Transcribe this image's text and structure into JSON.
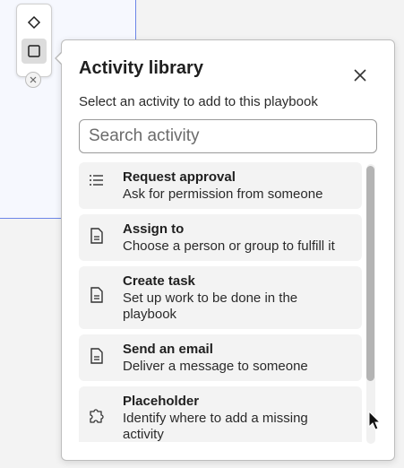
{
  "toolbar": {
    "tools": [
      {
        "name": "diamond-icon",
        "active": false
      },
      {
        "name": "square-icon",
        "active": true
      }
    ]
  },
  "popover": {
    "title": "Activity library",
    "subtitle": "Select an activity to add to this playbook",
    "search_placeholder": "Search activity",
    "search_value": "",
    "items": [
      {
        "icon": "list-icon",
        "title": "Request approval",
        "description": "Ask for permission from someone"
      },
      {
        "icon": "document-icon",
        "title": "Assign to",
        "description": "Choose a person or group to fulfill it"
      },
      {
        "icon": "document-icon",
        "title": "Create task",
        "description": "Set up work to be done in the playbook"
      },
      {
        "icon": "document-icon",
        "title": "Send an email",
        "description": "Deliver a message to someone"
      },
      {
        "icon": "puzzle-icon",
        "title": "Placeholder",
        "description": "Identify where to add a missing activity"
      }
    ]
  },
  "colors": {
    "canvas_border": "#6c86e8",
    "item_bg": "#f3f3f3",
    "scroll_thumb": "#b4b4b4"
  }
}
